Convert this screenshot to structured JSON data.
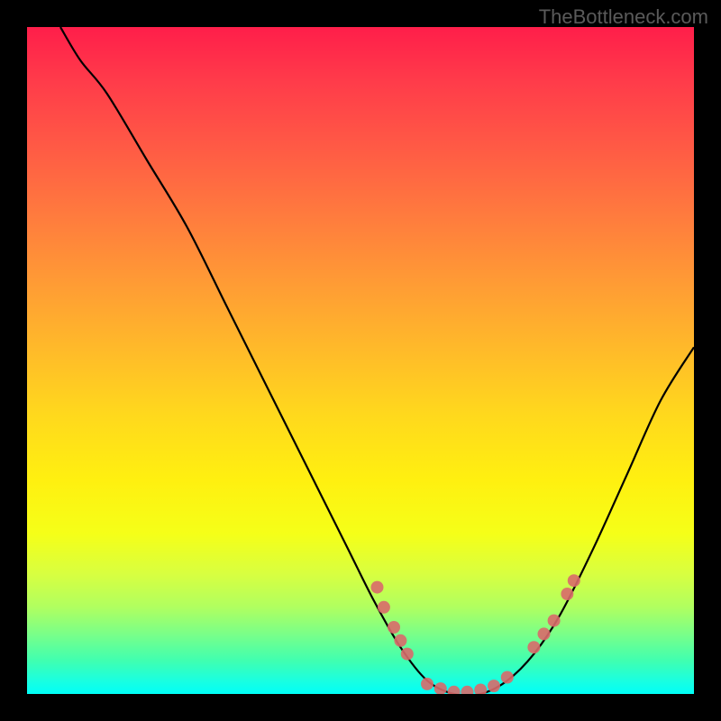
{
  "watermark": "TheBottleneck.com",
  "chart_data": {
    "type": "line",
    "title": "",
    "xlabel": "",
    "ylabel": "",
    "xlim": [
      0,
      100
    ],
    "ylim": [
      0,
      100
    ],
    "background": "rainbow-gradient-vertical",
    "curve_points": [
      {
        "x": 5,
        "y": 100
      },
      {
        "x": 8,
        "y": 95
      },
      {
        "x": 12,
        "y": 90
      },
      {
        "x": 18,
        "y": 80
      },
      {
        "x": 24,
        "y": 70
      },
      {
        "x": 30,
        "y": 58
      },
      {
        "x": 36,
        "y": 46
      },
      {
        "x": 42,
        "y": 34
      },
      {
        "x": 48,
        "y": 22
      },
      {
        "x": 52,
        "y": 14
      },
      {
        "x": 56,
        "y": 7
      },
      {
        "x": 60,
        "y": 2
      },
      {
        "x": 64,
        "y": 0
      },
      {
        "x": 68,
        "y": 0
      },
      {
        "x": 72,
        "y": 2
      },
      {
        "x": 76,
        "y": 6
      },
      {
        "x": 80,
        "y": 12
      },
      {
        "x": 85,
        "y": 22
      },
      {
        "x": 90,
        "y": 33
      },
      {
        "x": 95,
        "y": 44
      },
      {
        "x": 100,
        "y": 52
      }
    ],
    "marker_points": [
      {
        "x": 52.5,
        "y": 16
      },
      {
        "x": 53.5,
        "y": 13
      },
      {
        "x": 55,
        "y": 10
      },
      {
        "x": 56,
        "y": 8
      },
      {
        "x": 57,
        "y": 6
      },
      {
        "x": 60,
        "y": 1.5
      },
      {
        "x": 62,
        "y": 0.8
      },
      {
        "x": 64,
        "y": 0.3
      },
      {
        "x": 66,
        "y": 0.3
      },
      {
        "x": 68,
        "y": 0.6
      },
      {
        "x": 70,
        "y": 1.2
      },
      {
        "x": 72,
        "y": 2.5
      },
      {
        "x": 76,
        "y": 7
      },
      {
        "x": 77.5,
        "y": 9
      },
      {
        "x": 79,
        "y": 11
      },
      {
        "x": 81,
        "y": 15
      },
      {
        "x": 82,
        "y": 17
      }
    ],
    "colors": {
      "curve": "#000000",
      "markers": "#d96a6a",
      "gradient_top": "#ff1e4a",
      "gradient_bottom": "#00fff8"
    }
  }
}
